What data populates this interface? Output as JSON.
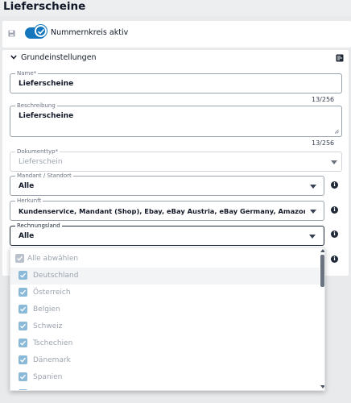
{
  "page": {
    "title": "Lieferscheine"
  },
  "toolbar": {
    "toggle_label": "Nummernkreis aktiv",
    "toggle_on": true
  },
  "section": {
    "title": "Grundeinstellungen"
  },
  "fields": {
    "name": {
      "label": "Name*",
      "value": "Lieferscheine",
      "counter": "13/256"
    },
    "description": {
      "label": "Beschreibung",
      "value": "Lieferscheine",
      "counter": "13/256"
    },
    "document_type": {
      "label": "Dokumenttyp*",
      "value": "Lieferschein"
    },
    "client": {
      "label": "Mandant / Standort",
      "value": "Alle"
    },
    "origin": {
      "label": "Herkunft",
      "value": "Kundenservice, Mandant (Shop), Ebay, eBay Austria, eBay Germany, Amazon, Amazon Ger..."
    },
    "billing_country": {
      "label": "Rechnungsland",
      "value": "Alle"
    }
  },
  "dropdown": {
    "deselect_all": "Alle abwählen",
    "options": [
      "Deutschland",
      "Österreich",
      "Belgien",
      "Schweiz",
      "Tschechien",
      "Dänemark",
      "Spanien"
    ]
  },
  "colors": {
    "accent": "#1477bd",
    "checkbox": "#8bbad8"
  }
}
